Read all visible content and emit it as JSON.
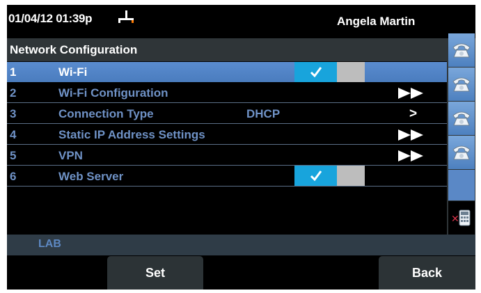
{
  "header": {
    "datetime": "01/04/12 01:39p",
    "user_name": "Angela Martin"
  },
  "title": "Network Configuration",
  "rows": [
    {
      "num": "1",
      "label": "Wi-Fi",
      "control": "toggle",
      "toggle_on": true,
      "selected": true
    },
    {
      "num": "2",
      "label": "Wi-Fi Configuration",
      "control": "submenu-double-arrow"
    },
    {
      "num": "3",
      "label": "Connection Type",
      "value": "DHCP",
      "control": "submenu",
      "arrow": ">"
    },
    {
      "num": "4",
      "label": "Static IP Address Settings",
      "control": "submenu-double-arrow"
    },
    {
      "num": "5",
      "label": "VPN",
      "control": "submenu-double-arrow"
    },
    {
      "num": "6",
      "label": "Web Server",
      "control": "toggle",
      "toggle_on": true
    }
  ],
  "status": {
    "text": "LAB"
  },
  "softkeys": {
    "set": "Set",
    "back": "Back"
  },
  "line_buttons": [
    "phone-icon",
    "phone-icon",
    "phone-icon",
    "phone-icon",
    "empty",
    "phone-keypad-error-icon"
  ],
  "colors": {
    "selected_row": "#5a8ccf",
    "toggle_on": "#18a4dc",
    "toggle_off": "#bdbdbd",
    "row_text": "#6f92c6",
    "title_bar": "#2f3538"
  }
}
